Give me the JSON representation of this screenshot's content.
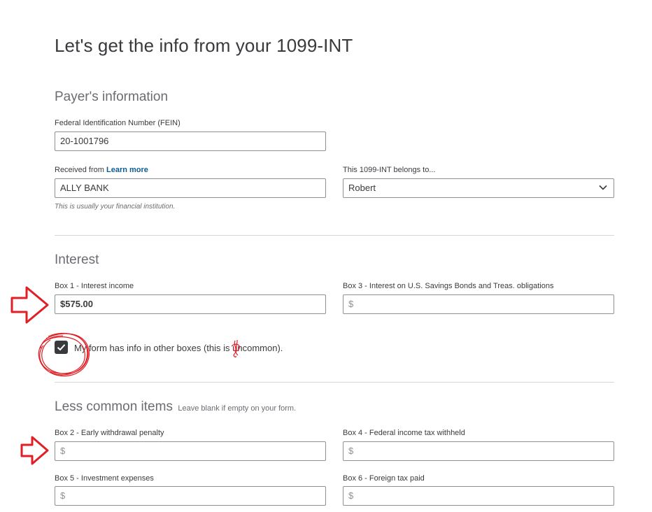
{
  "page_title": "Let's get the info from your 1099-INT",
  "payer": {
    "title": "Payer's information",
    "fein": {
      "label": "Federal Identification Number (FEIN)",
      "value": "20-1001796"
    },
    "received_from": {
      "label": "Received from",
      "link": "Learn more",
      "value": "ALLY BANK",
      "hint": "This is usually your financial institution."
    },
    "belongs_to": {
      "label": "This 1099-INT belongs to...",
      "value": "Robert"
    }
  },
  "interest": {
    "title": "Interest",
    "box1": {
      "label": "Box 1 - Interest income",
      "value": "$575.00"
    },
    "box3": {
      "label": "Box 3 - Interest on U.S. Savings Bonds and Treas. obligations",
      "placeholder": "$"
    },
    "other_boxes": {
      "label": "My form has info in other boxes (this is uncommon).",
      "checked": true
    }
  },
  "less_common": {
    "title": "Less common items",
    "note": "Leave blank if empty on your form.",
    "box2": {
      "label": "Box 2 - Early withdrawal penalty",
      "placeholder": "$"
    },
    "box4": {
      "label": "Box 4 - Federal income tax withheld",
      "placeholder": "$"
    },
    "box5": {
      "label": "Box 5 - Investment expenses",
      "placeholder": "$"
    },
    "box6": {
      "label": "Box 6 - Foreign tax paid",
      "placeholder": "$"
    }
  },
  "colors": {
    "annotation": "#e01f26",
    "link": "#0d5c8f",
    "text": "#393a3d",
    "border": "#8d9096"
  }
}
